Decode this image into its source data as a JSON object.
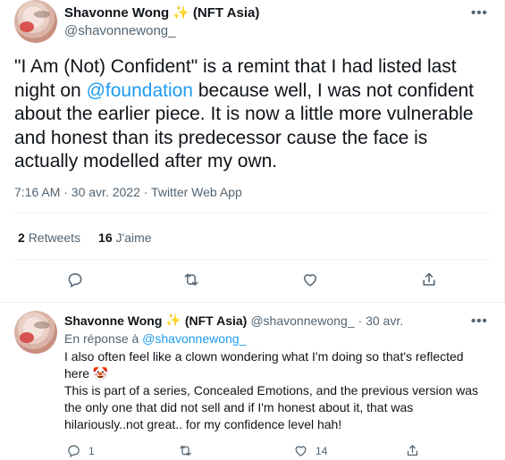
{
  "main_tweet": {
    "display_name": "Shavonne Wong",
    "name_suffix": "(NFT Asia)",
    "sparkle_icon": "sparkles-emoji",
    "handle": "@shavonnewong_",
    "more_label": "•••",
    "text_before": "\"I Am (Not) Confident\" is a remint that I had listed last night on ",
    "mention": "@foundation",
    "text_after": " because well, I was not confident about the earlier piece. It is now a little more vulnerable and honest than its predecessor cause the face is actually modelled after my own.",
    "timestamp": "7:16 AM · 30 avr. 2022 · Twitter Web App",
    "retweets_count": "2",
    "retweets_label": "Retweets",
    "likes_count": "16",
    "likes_label": "J'aime",
    "actions": [
      "reply-icon",
      "retweet-icon",
      "like-icon",
      "share-icon"
    ]
  },
  "reply_tweet": {
    "display_name": "Shavonne Wong",
    "name_suffix": "(NFT Asia)",
    "handle": "@shavonnewong_",
    "date": "· 30 avr.",
    "more_label": "•••",
    "replying_prefix": "En réponse à ",
    "replying_handle": "@shavonnewong_",
    "line1": "I also often feel like a clown wondering what I'm doing so that's reflected here 🤡",
    "line2": "This is part of a series, Concealed Emotions, and the previous version was the only one that did not sell and if I'm honest about it, that was hilariously..not great.. for my confidence level hah!",
    "reply_count": "1",
    "retweet_count": "",
    "like_count": "14",
    "colors": {
      "link": "#1d9bf0",
      "muted": "#536471",
      "text": "#0f1419"
    }
  }
}
